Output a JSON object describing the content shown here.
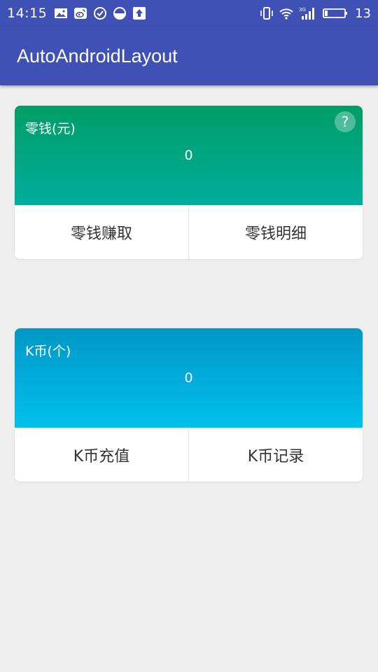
{
  "status_bar": {
    "time": "14:15",
    "left_icons": [
      "image-icon",
      "weibo-icon",
      "check-circle-icon",
      "half-circle-icon",
      "upload-icon"
    ],
    "right_icons": [
      "vibrate-icon",
      "wifi-icon",
      "signal-3g-icon",
      "battery-icon"
    ],
    "signal_tag": "3G",
    "battery_level": "13"
  },
  "app_bar": {
    "title": "AutoAndroidLayout"
  },
  "wallet_card": {
    "label": "零钱(元)",
    "value": "0",
    "help_symbol": "?",
    "actions": [
      "零钱赚取",
      "零钱明细"
    ]
  },
  "kcoin_card": {
    "label": "K币(个)",
    "value": "0",
    "actions": [
      "K币充值",
      "K币记录"
    ]
  },
  "colors": {
    "primary": "#3f51b5",
    "wallet_gradient": [
      "#009e66",
      "#00ad9d"
    ],
    "kcoin_gradient": [
      "#0097c6",
      "#00c0ec"
    ],
    "background": "#eeeeee"
  }
}
